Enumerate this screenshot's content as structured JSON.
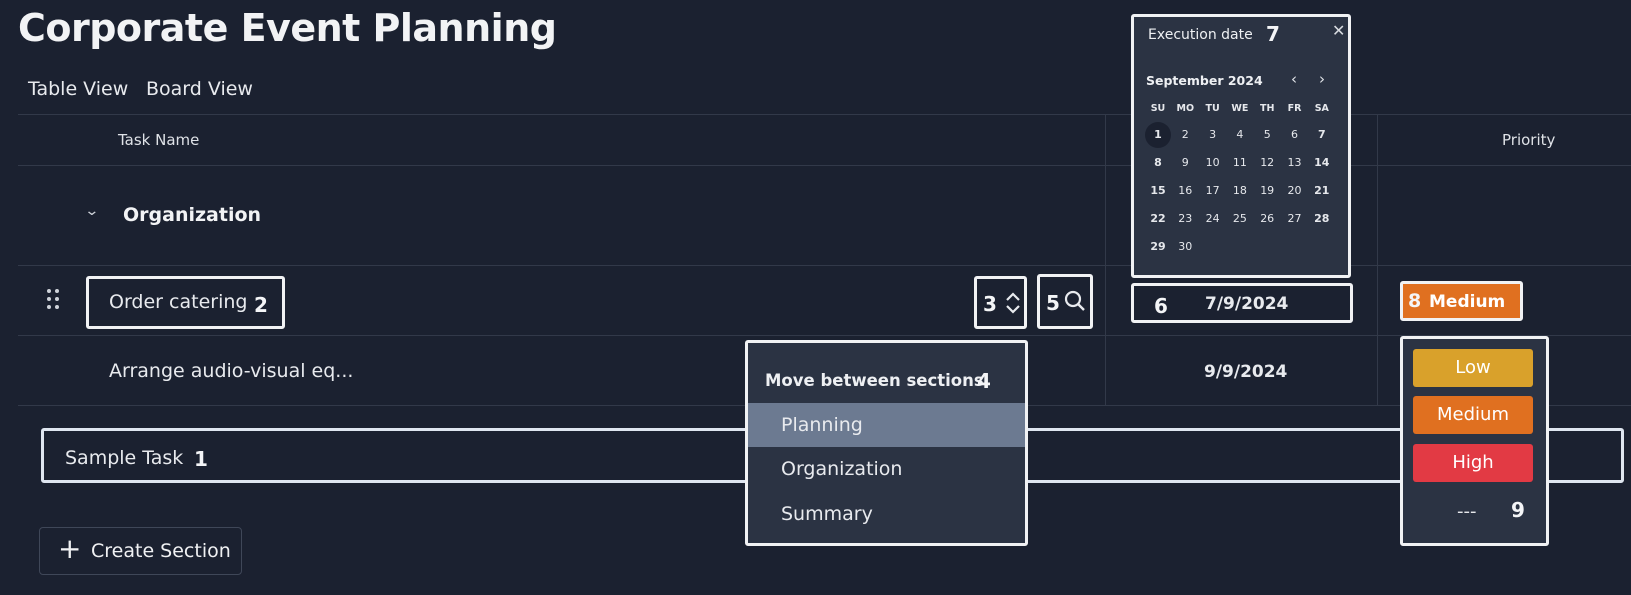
{
  "page_title": "Corporate Event Planning",
  "views": [
    "Table View",
    "Board View"
  ],
  "columns": {
    "task_name": "Task Name",
    "priority": "Priority"
  },
  "section": {
    "name": "Organization"
  },
  "tasks": [
    {
      "name": "Order catering",
      "date": "7/9/2024",
      "priority": "Medium"
    },
    {
      "name": "Arrange audio-visual eq...",
      "date": "9/9/2024"
    }
  ],
  "new_task_input": {
    "value": "Sample Task"
  },
  "create_section_label": "Create Section",
  "annotations": [
    "1",
    "2",
    "3",
    "4",
    "5",
    "6",
    "7",
    "8",
    "9"
  ],
  "calendar": {
    "title": "Execution date",
    "month": "September 2024",
    "weekdays": [
      "SU",
      "MO",
      "TU",
      "WE",
      "TH",
      "FR",
      "SA"
    ],
    "days": [
      "1",
      "2",
      "3",
      "4",
      "5",
      "6",
      "7",
      "8",
      "9",
      "10",
      "11",
      "12",
      "13",
      "14",
      "15",
      "16",
      "17",
      "18",
      "19",
      "20",
      "21",
      "22",
      "23",
      "24",
      "25",
      "26",
      "27",
      "28",
      "29",
      "30"
    ],
    "selected_day": "1"
  },
  "move_menu": {
    "title": "Move between sections",
    "items": [
      "Planning",
      "Organization",
      "Summary"
    ],
    "active": "Planning"
  },
  "priority_menu": {
    "options": [
      {
        "label": "Low",
        "color": "#d9a12b"
      },
      {
        "label": "Medium",
        "color": "#e07020"
      },
      {
        "label": "High",
        "color": "#e23a44"
      }
    ],
    "empty_label": "---"
  },
  "colors": {
    "background": "#1b2130",
    "panel": "#2b3343",
    "medium_badge": "#e07020",
    "menu_active": "#6c7a91"
  }
}
